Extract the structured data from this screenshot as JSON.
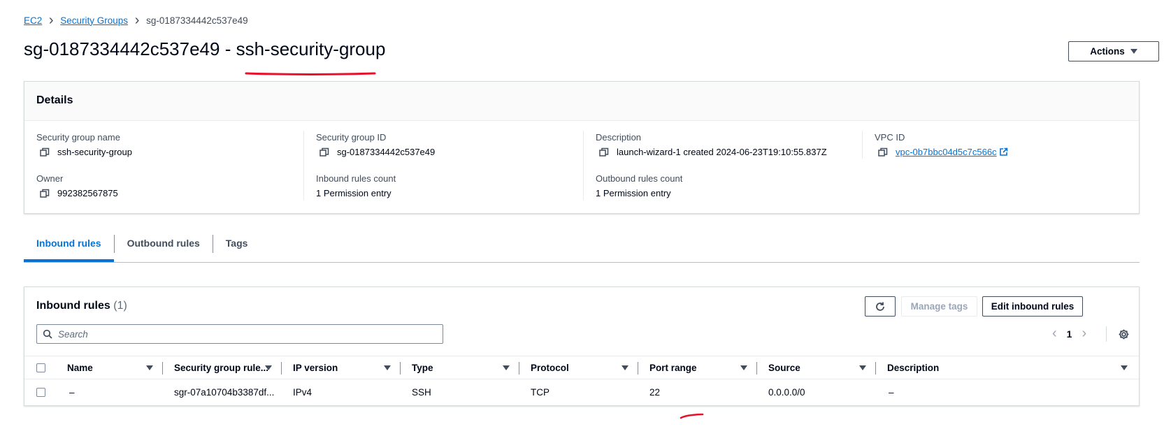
{
  "breadcrumb": {
    "ec2": "EC2",
    "security_groups": "Security Groups",
    "current": "sg-0187334442c537e49"
  },
  "title": "sg-0187334442c537e49 - ssh-security-group",
  "actions_label": "Actions",
  "details": {
    "heading": "Details",
    "sg_name_label": "Security group name",
    "sg_name": "ssh-security-group",
    "sg_id_label": "Security group ID",
    "sg_id": "sg-0187334442c537e49",
    "description_label": "Description",
    "description": "launch-wizard-1 created 2024-06-23T19:10:55.837Z",
    "vpc_id_label": "VPC ID",
    "vpc_id": "vpc-0b7bbc04d5c7c566c",
    "owner_label": "Owner",
    "owner": "992382567875",
    "inbound_count_label": "Inbound rules count",
    "inbound_count": "1 Permission entry",
    "outbound_count_label": "Outbound rules count",
    "outbound_count": "1 Permission entry"
  },
  "tabs": [
    "Inbound rules",
    "Outbound rules",
    "Tags"
  ],
  "inbound": {
    "heading": "Inbound rules",
    "count": "(1)",
    "manage_tags": "Manage tags",
    "edit_rules": "Edit inbound rules",
    "search_placeholder": "Search",
    "page": "1",
    "columns": [
      "Name",
      "Security group rule...",
      "IP version",
      "Type",
      "Protocol",
      "Port range",
      "Source",
      "Description"
    ],
    "rows": [
      [
        "–",
        "sgr-07a10704b3387df...",
        "IPv4",
        "SSH",
        "TCP",
        "22",
        "0.0.0.0/0",
        "–"
      ]
    ]
  },
  "colors": {
    "accent": "#0972d3",
    "annotation": "#e8112d"
  }
}
